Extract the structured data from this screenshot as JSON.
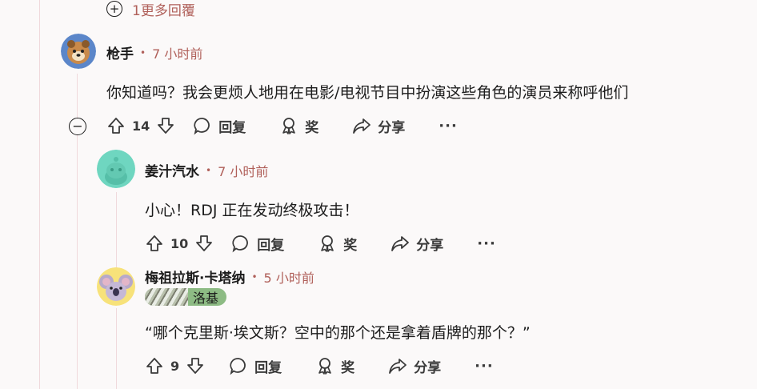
{
  "more_replies": {
    "label": "1更多回覆"
  },
  "comments": [
    {
      "author": "枪手",
      "time": "7 小时前",
      "body": "你知道吗？我会更烦人地用在电影/电视节目中扮演这些角色的演员来称呼他们",
      "votes": "14",
      "reply_label": "回复",
      "award_label": "奖",
      "share_label": "分享"
    },
    {
      "author": "姜汁汽水",
      "time": "7 小时前",
      "body": "小心！RDJ 正在发动终极攻击！",
      "votes": "10",
      "reply_label": "回复",
      "award_label": "奖",
      "share_label": "分享"
    },
    {
      "author": "梅祖拉斯·卡塔纳",
      "time": "5 小时前",
      "flair": "洛基",
      "body": "“哪个克里斯·埃文斯？空中的那个还是拿着盾牌的那个？”",
      "votes": "9",
      "reply_label": "回复",
      "award_label": "奖",
      "share_label": "分享"
    }
  ],
  "icons": {
    "expand": "plus-circle-icon",
    "collapse": "minus-circle-icon",
    "upvote": "arrow-up-icon",
    "downvote": "arrow-down-icon",
    "reply": "chat-bubble-icon",
    "award": "award-icon",
    "share": "share-arrow-icon",
    "more": "more-dots-icon"
  },
  "colors": {
    "background": "#fbf9f9",
    "meta_accent": "#b0605a",
    "thread_line": "#f0d9dc",
    "flair_bg": "#8dbb84"
  }
}
